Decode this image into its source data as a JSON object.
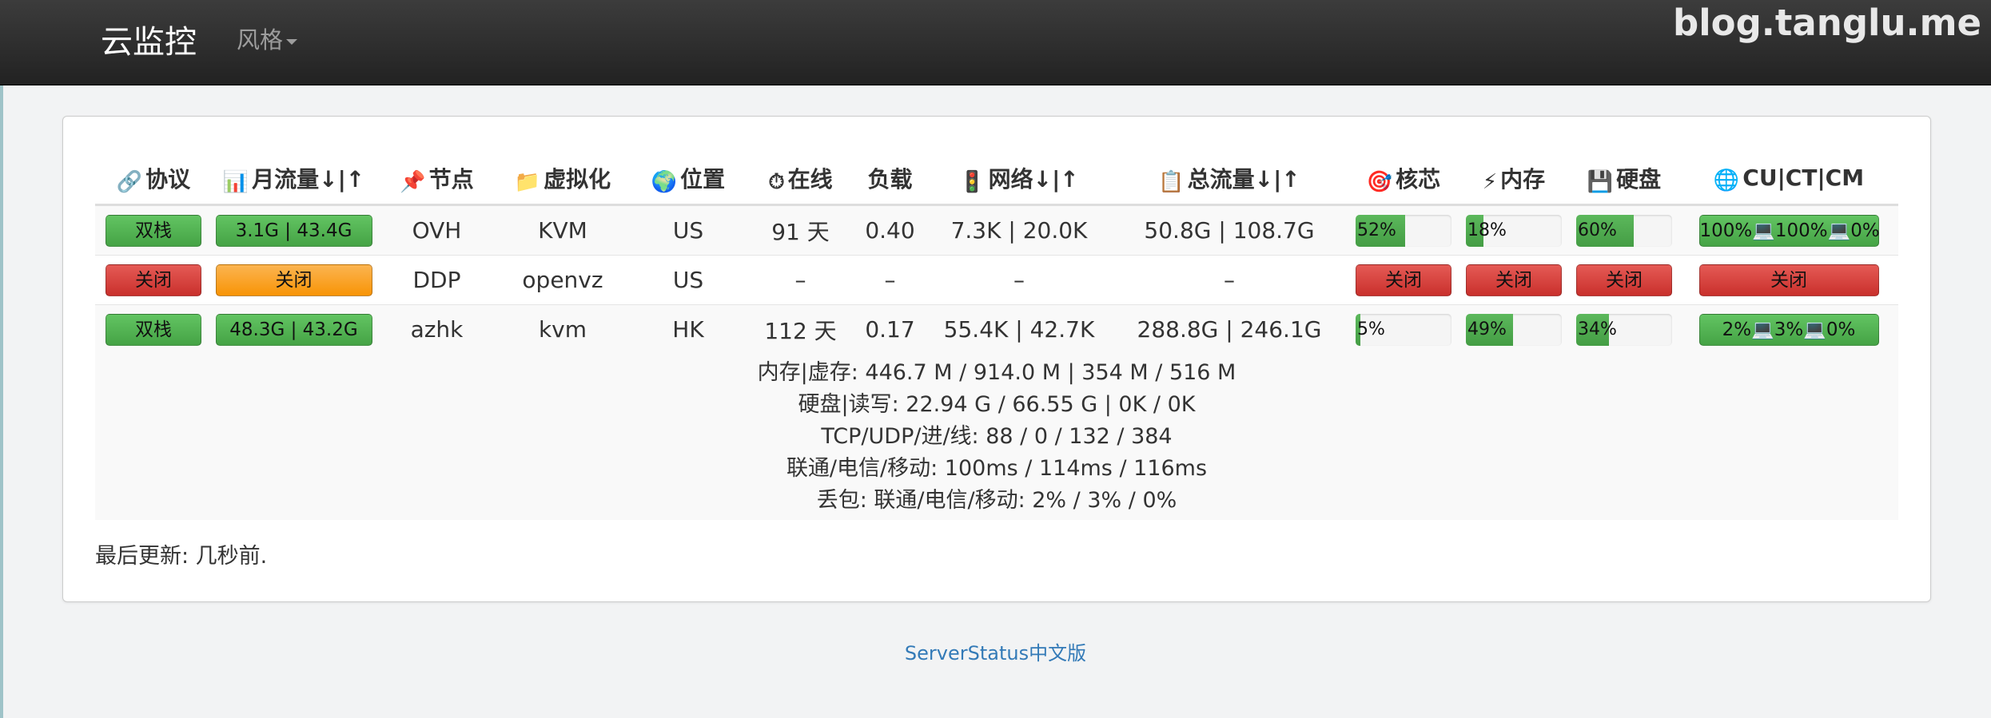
{
  "nav": {
    "brand": "云监控",
    "style_menu": "风格",
    "watermark": "blog.tanglu.me"
  },
  "headers": [
    {
      "icon": "🔗",
      "label": "协议",
      "icon_name": "link-icon"
    },
    {
      "icon": "📊",
      "label": "月流量↓|↑",
      "icon_name": "bar-chart-icon"
    },
    {
      "icon": "📌",
      "label": "节点",
      "icon_name": "pushpin-icon"
    },
    {
      "icon": "📁",
      "label": "虚拟化",
      "icon_name": "folder-icon"
    },
    {
      "icon": "🌍",
      "label": "位置",
      "icon_name": "globe-icon"
    },
    {
      "icon": "⏱",
      "label": "在线",
      "icon_name": "stopwatch-icon"
    },
    {
      "icon": "",
      "label": "负载",
      "icon_name": ""
    },
    {
      "icon": "🚦",
      "label": "网络↓|↑",
      "icon_name": "traffic-light-icon"
    },
    {
      "icon": "📋",
      "label": "总流量↓|↑",
      "icon_name": "clipboard-icon"
    },
    {
      "icon": "🎯",
      "label": "核芯",
      "icon_name": "target-icon"
    },
    {
      "icon": "⚡",
      "label": "内存",
      "icon_name": "lightning-icon"
    },
    {
      "icon": "💾",
      "label": "硬盘",
      "icon_name": "floppy-disk-icon"
    },
    {
      "icon": "🌐",
      "label": "CU|CT|CM",
      "icon_name": "globe-meridians-icon"
    }
  ],
  "rows": [
    {
      "protocol": "双栈",
      "monthly": "3.1G | 43.4G",
      "node": "OVH",
      "virt": "KVM",
      "location": "US",
      "uptime": "91 天",
      "load": "0.40",
      "network": "7.3K | 20.0K",
      "total": "50.8G | 108.7G",
      "cpu": "52%",
      "cpu_value": 0.52,
      "mem": "18%",
      "mem_value": 0.18,
      "disk": "60%",
      "disk_value": 0.6,
      "ping": "100%💻100%💻0%"
    },
    {
      "protocol": "关闭",
      "monthly": "关闭",
      "node": "DDP",
      "virt": "openvz",
      "location": "US",
      "uptime": "–",
      "load": "–",
      "network": "–",
      "total": "–",
      "cpu": "关闭",
      "mem": "关闭",
      "disk": "关闭",
      "ping": "关闭"
    },
    {
      "protocol": "双栈",
      "monthly": "48.3G | 43.2G",
      "node": "azhk",
      "virt": "kvm",
      "location": "HK",
      "uptime": "112 天",
      "load": "0.17",
      "network": "55.4K | 42.7K",
      "total": "288.8G | 246.1G",
      "cpu": "5%",
      "cpu_value": 0.05,
      "mem": "49%",
      "mem_value": 0.49,
      "disk": "34%",
      "disk_value": 0.34,
      "ping": "2%💻3%💻0%"
    }
  ],
  "details": [
    "内存|虚存: 446.7 M / 914.0 M | 354 M / 516 M",
    "硬盘|读写: 22.94 G / 66.55 G | 0K / 0K",
    "TCP/UDP/进/线: 88 / 0 / 132 / 384",
    "联通/电信/移动: 100ms / 114ms / 116ms",
    "丢包: 联通/电信/移动: 2% / 3% / 0%"
  ],
  "updated": "最后更新: 几秒前.",
  "footer": "ServerStatus中文版",
  "colors": {
    "green": "#5cb85c",
    "red": "#d9534f",
    "orange": "#f89406",
    "link": "#337ab7"
  }
}
